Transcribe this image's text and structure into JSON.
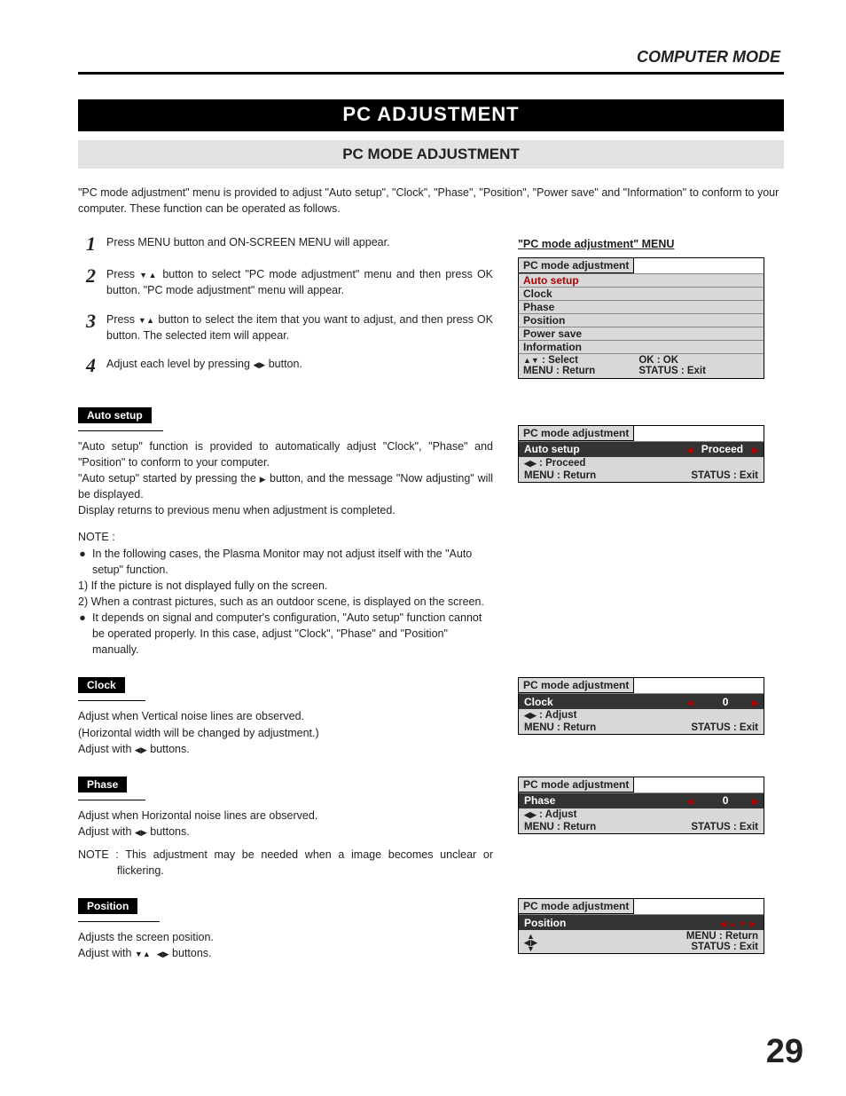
{
  "header": "COMPUTER MODE",
  "title": "PC ADJUSTMENT",
  "subtitle": "PC MODE ADJUSTMENT",
  "intro": "\"PC mode adjustment\" menu is provided to adjust \"Auto setup\", \"Clock\", \"Phase\", \"Position\", \"Power save\" and \"Information\" to conform to your computer.  These function can be operated as follows.",
  "steps": {
    "s1": "Press MENU button and ON-SCREEN MENU will appear.",
    "s2a": "Press ",
    "s2b": " button to select \"PC mode adjustment\" menu and then press OK button. \"PC mode adjustment\" menu will appear.",
    "s3a": "Press ",
    "s3b": " button to select the item that you want to adjust, and then press OK button. The selected item will appear.",
    "s4a": "Adjust each level by pressing ",
    "s4b": " button."
  },
  "menu": {
    "caption": "\"PC mode adjustment\" MENU",
    "title": "PC mode adjustment",
    "items": [
      "Auto setup",
      "Clock",
      "Phase",
      "Position",
      "Power save",
      "Information"
    ],
    "foot_select": " : Select",
    "foot_ok": "OK  :  OK",
    "foot_menu": "MENU     :  Return",
    "foot_status": "STATUS   :   Exit"
  },
  "auto": {
    "heading": "Auto setup",
    "p1": "\"Auto setup\" function is provided to automatically adjust \"Clock\", \"Phase\" and \"Position\" to conform to your computer.",
    "p2a": "\"Auto setup\" started by pressing the ",
    "p2b": " button, and the message \"Now adjusting\" will be displayed.",
    "p3": "Display returns to previous menu when adjustment is completed.",
    "note_label": "NOTE :",
    "n1": "In the following cases, the Plasma Monitor may not adjust itself with the \"Auto setup\" function.",
    "n1a": "1) If the picture is not displayed fully on the screen.",
    "n1b": "2) When a contrast pictures, such as an outdoor scene, is displayed on the screen.",
    "n2": "It depends on signal and computer's configuration, \"Auto setup\" function cannot be operated properly. In this case, adjust \"Clock\", \"Phase\" and \"Position\" manually.",
    "osd_row": "Auto setup",
    "osd_proceed": "Proceed",
    "osd_hint": " : Proceed",
    "osd_menu": "MENU   :  Return",
    "osd_status": "STATUS  :  Exit"
  },
  "clock": {
    "heading": "Clock",
    "p1": "Adjust when Vertical noise lines are observed.",
    "p2": "(Horizontal width will be changed by adjustment.)",
    "p3a": "Adjust with ",
    "p3b": " buttons.",
    "osd_row": "Clock",
    "osd_val": "0",
    "osd_hint": " : Adjust",
    "osd_menu": "MENU   :  Return",
    "osd_status": "STATUS  :  Exit"
  },
  "phase": {
    "heading": "Phase",
    "p1": "Adjust when Horizontal noise lines are observed.",
    "p2a": "Adjust with ",
    "p2b": " buttons.",
    "note": "NOTE : This adjustment may be needed when a image becomes unclear or flickering.",
    "osd_row": "Phase",
    "osd_val": "0",
    "osd_hint": " : Adjust",
    "osd_menu": "MENU   :  Return",
    "osd_status": "STATUS  :  Exit"
  },
  "position": {
    "heading": "Position",
    "p1": "Adjusts the screen position.",
    "p2a": "Adjust with ",
    "p2b": " buttons.",
    "osd_row": "Position",
    "osd_menu": "MENU   : Return",
    "osd_status": "STATUS : Exit"
  },
  "page_number": "29"
}
